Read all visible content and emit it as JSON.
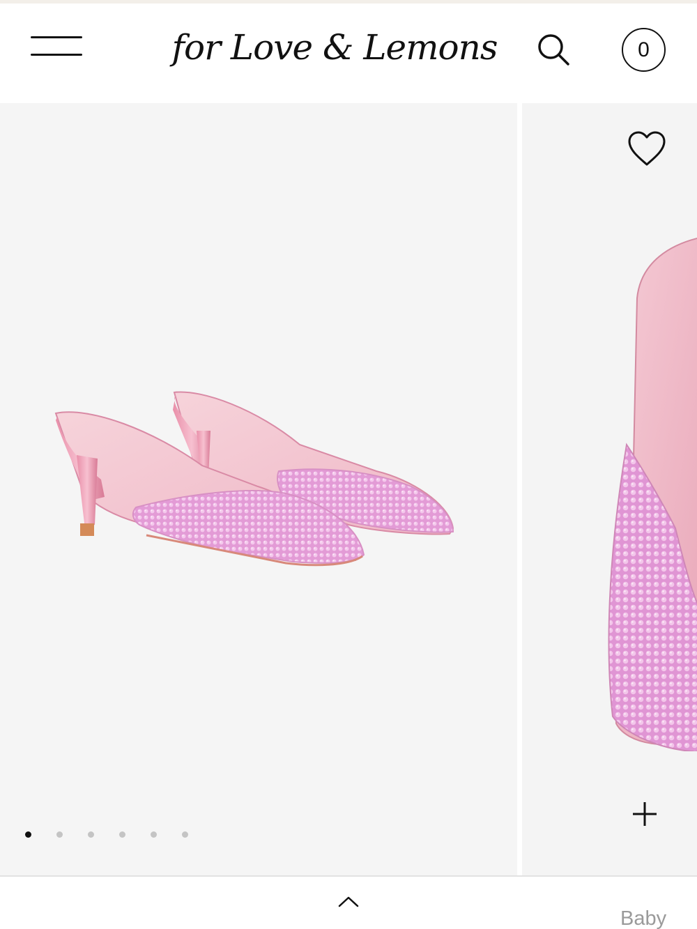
{
  "header": {
    "logo_text": "for Love & Lemons",
    "cart_count": "0",
    "icons": {
      "menu": "hamburger-menu-icon",
      "search": "search-icon",
      "cart": "cart-count-icon"
    }
  },
  "gallery": {
    "slide_count": 6,
    "active_slide": 1,
    "icons": {
      "wishlist": "heart-icon",
      "add": "plus-icon"
    }
  },
  "footer": {
    "peek_label": "Baby",
    "icons": {
      "expand": "chevron-up-icon"
    }
  },
  "colors": {
    "shoe_pink": "#e9a3d6",
    "shoe_lining": "#f2c4cf",
    "background": "#f5f5f5",
    "text": "#111111",
    "muted": "#9a9a9a"
  }
}
